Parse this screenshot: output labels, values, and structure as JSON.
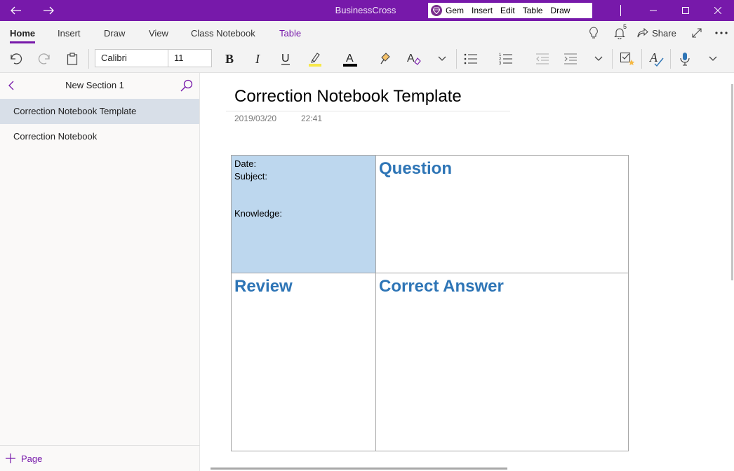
{
  "titlebar": {
    "app_title": "BusinessCross",
    "gem_menu": [
      "Gem",
      "Insert",
      "Edit",
      "Table",
      "Draw"
    ],
    "accent": "#7719aa"
  },
  "ribbon": {
    "tabs": [
      "Home",
      "Insert",
      "Draw",
      "View",
      "Class Notebook",
      "Table"
    ],
    "notification_count": "5",
    "share_label": "Share"
  },
  "toolbar": {
    "font_name": "Calibri",
    "font_size": "11"
  },
  "sidebar": {
    "section_title": "New Section 1",
    "pages": [
      "Correction Notebook Template",
      "Correction Notebook"
    ],
    "add_page_label": "Page"
  },
  "page": {
    "title": "Correction Notebook Template",
    "date": "2019/03/20",
    "time": "22:41",
    "table": {
      "date_label": "Date:",
      "subject_label": "Subject:",
      "knowledge_label": "Knowledge:",
      "question_heading": "Question",
      "review_heading": "Review",
      "correct_answer_heading": "Correct Answer",
      "cell_fill": "#bdd7ee",
      "heading_color": "#2e75b6"
    }
  }
}
